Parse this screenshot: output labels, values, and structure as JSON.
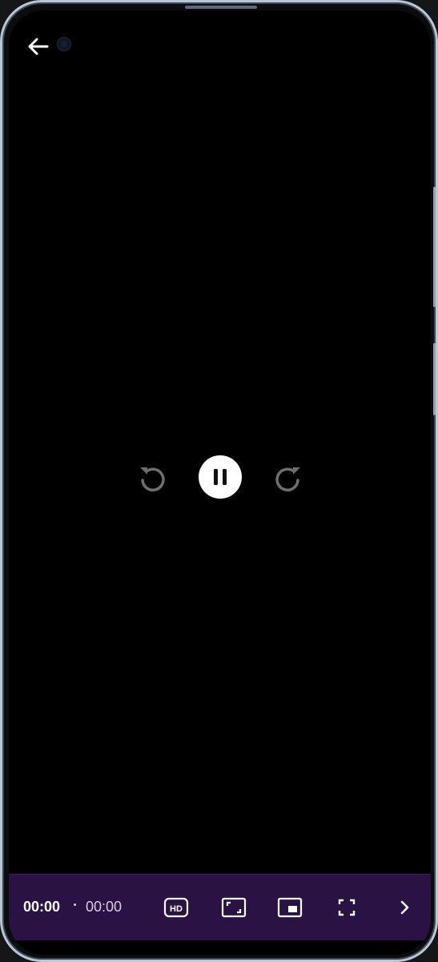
{
  "player": {
    "current_time": "00:00",
    "duration": "00:00",
    "state": "playing"
  },
  "controls": {
    "back": {
      "icon": "arrow-left-icon"
    },
    "rewind": {
      "icon": "rewind-icon"
    },
    "pause": {
      "icon": "pause-icon"
    },
    "forward": {
      "icon": "forward-icon"
    },
    "quality": {
      "icon": "hd-icon",
      "label": "HD"
    },
    "aspect": {
      "icon": "aspect-ratio-icon"
    },
    "pip": {
      "icon": "picture-in-picture-icon"
    },
    "fullscreen": {
      "icon": "fullscreen-icon"
    },
    "more": {
      "icon": "chevron-right-icon"
    }
  },
  "colors": {
    "screen": "#000000",
    "bar": "#2a1244",
    "icon": "#ffffff",
    "seek_icon": "#6e6e6e"
  }
}
